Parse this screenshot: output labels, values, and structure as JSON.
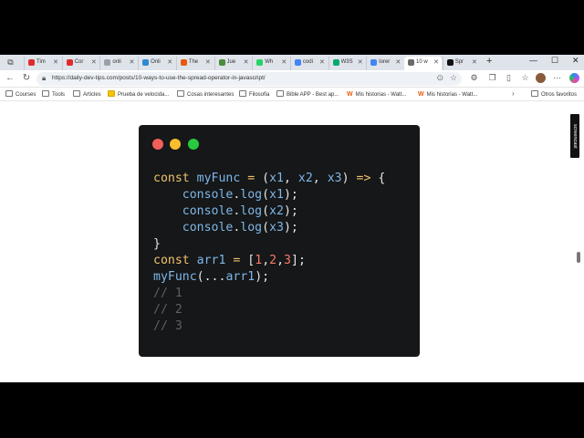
{
  "browser": {
    "tabs": [
      {
        "label": "Tim",
        "favicon": "youtube-icon",
        "color": "#e02b2b"
      },
      {
        "label": "Cor",
        "favicon": "youtube-icon",
        "color": "#e02b2b"
      },
      {
        "label": "onli",
        "favicon": "globe-icon",
        "color": "#9aa0a6"
      },
      {
        "label": "Onli",
        "favicon": "app-icon",
        "color": "#2f8ad4"
      },
      {
        "label": "The",
        "favicon": "wattpad-icon",
        "color": "#e8590c"
      },
      {
        "label": "Jue",
        "favicon": "figure-icon",
        "color": "#4a8c3a"
      },
      {
        "label": "Wh",
        "favicon": "whatsapp-icon",
        "color": "#25d366"
      },
      {
        "label": "codi",
        "favicon": "google-icon",
        "color": "#4285f4"
      },
      {
        "label": "W3S",
        "favicon": "w3schools-icon",
        "color": "#04aa6d"
      },
      {
        "label": "lorer",
        "favicon": "google-icon",
        "color": "#4285f4"
      },
      {
        "label": "10 w",
        "favicon": "code-icon",
        "color": "#6b6b6b"
      },
      {
        "label": "Spr",
        "favicon": "medium-icon",
        "color": "#111111"
      }
    ],
    "active_tab_index": 10,
    "url": "https://daily-dev-tips.com/posts/10-ways-to-use-the-spread-operator-in-javascript/",
    "bookmarks": [
      {
        "label": "Courses",
        "icon": "folder-icon"
      },
      {
        "label": "Tools",
        "icon": "folder-icon"
      },
      {
        "label": "Articles",
        "icon": "folder-icon"
      },
      {
        "label": "Prueba de velocida...",
        "icon": "speedtest-icon"
      },
      {
        "label": "Cosas interesantes",
        "icon": "folder-icon"
      },
      {
        "label": "Filosofia",
        "icon": "folder-icon"
      },
      {
        "label": "Bible APP - Best ap...",
        "icon": "folder-icon"
      },
      {
        "label": "Mis historias - Watt...",
        "icon": "wattpad-icon"
      },
      {
        "label": "Mis historias - Watt...",
        "icon": "wattpad-icon"
      },
      {
        "label": "Otros favoritos",
        "icon": "folder-icon"
      }
    ]
  },
  "page": {
    "code_card": {
      "window_dots": [
        "#f25f58",
        "#fbbd2e",
        "#29c940"
      ],
      "lines": [
        "const myFunc = (x1, x2, x3) => {",
        "    console.log(x1);",
        "    console.log(x2);",
        "    console.log(x3);",
        "}",
        "const arr1 = [1,2,3];",
        "myFunc(...arr1);",
        "// 1",
        "// 2",
        "// 3"
      ]
    },
    "badge": "screencast"
  },
  "colors": {
    "keyword": "#f2c26b",
    "variable": "#7fb6e8",
    "number": "#f47c6a",
    "comment": "#5d6064",
    "code_bg": "#151718"
  }
}
